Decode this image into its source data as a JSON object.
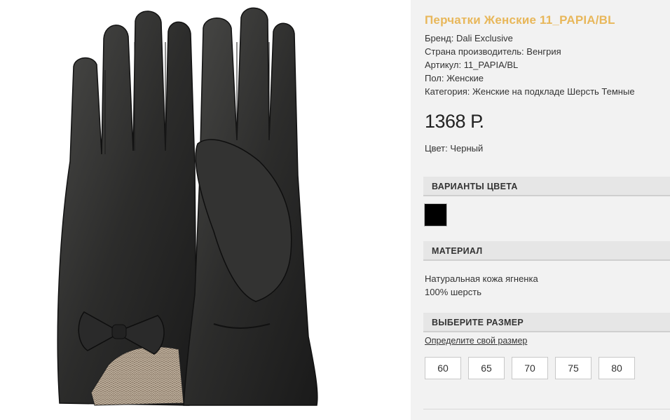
{
  "product": {
    "title": "Перчатки Женские 11_PAPIA/BL",
    "properties": [
      "Бренд: Dali Exclusive",
      "Страна производитель: Венгрия",
      "Артикул: 11_PAPIA/BL",
      "Пол: Женские",
      "Категория: Женские на подкладе Шерсть Темные"
    ],
    "price": "1368 Р.",
    "color_line": "Цвет: Черный"
  },
  "sections": {
    "colors": "ВАРИАНТЫ ЦВЕТА",
    "material": "МАТЕРИАЛ",
    "size": "ВЫБЕРИТЕ РАЗМЕР"
  },
  "color_swatch": {
    "color": "#000000"
  },
  "material_lines": [
    "Натуральная кожа ягненка",
    "100% шерсть"
  ],
  "size_link": "Определите свой размер",
  "sizes": [
    "60",
    "65",
    "70",
    "75",
    "80"
  ],
  "image": {
    "icon": "gloves-product-photo"
  }
}
